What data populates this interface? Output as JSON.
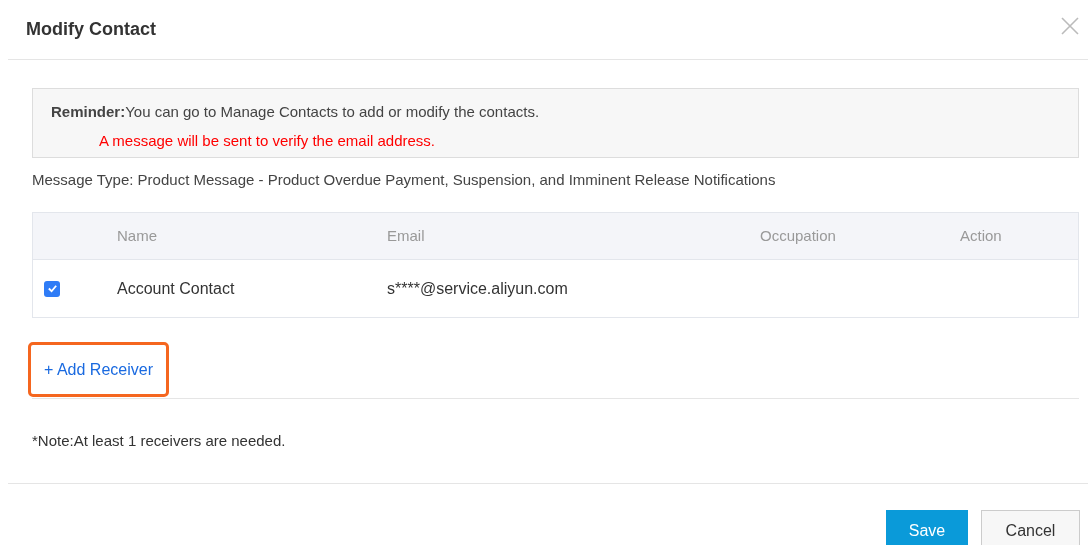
{
  "dialog": {
    "title": "Modify Contact"
  },
  "reminder": {
    "label": "Reminder:",
    "text": "You can go to Manage Contacts to add or modify the contacts.",
    "warning": "A message will be sent to verify the email address."
  },
  "message_type": "Message Type: Product Message - Product Overdue Payment, Suspension, and Imminent Release Notifications",
  "table": {
    "columns": [
      "Name",
      "Email",
      "Occupation",
      "Action"
    ],
    "rows": [
      {
        "checked": true,
        "name": "Account Contact",
        "email": "s****@service.aliyun.com"
      }
    ]
  },
  "add_receiver": {
    "label": "+ Add Receiver",
    "highlighted": true
  },
  "note": "*Note:At least 1 receivers are needed.",
  "buttons": [
    {
      "label": "Save",
      "kind": "primary"
    },
    {
      "label": "Cancel",
      "kind": "secondary"
    }
  ]
}
